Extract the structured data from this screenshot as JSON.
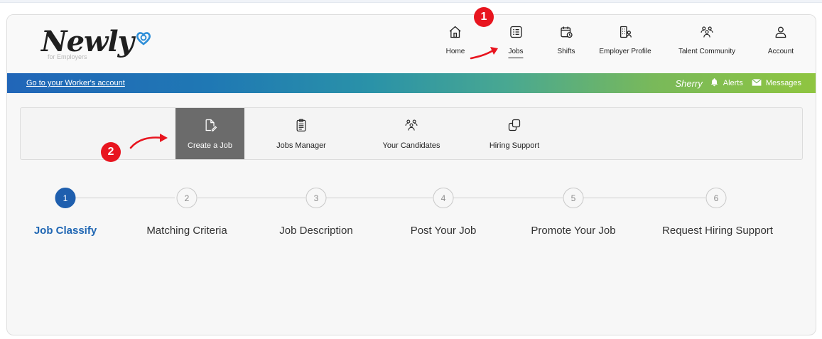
{
  "brand": {
    "name": "Newly",
    "tagline": "for Employers"
  },
  "topnav": {
    "items": [
      {
        "label": "Home",
        "icon": "home-icon"
      },
      {
        "label": "Jobs",
        "icon": "jobs-list-icon",
        "active": true
      },
      {
        "label": "Shifts",
        "icon": "calendar-icon"
      },
      {
        "label": "Employer Profile",
        "icon": "building-profile-icon"
      },
      {
        "label": "Talent Community",
        "icon": "group-icon"
      },
      {
        "label": "Account",
        "icon": "person-icon"
      }
    ]
  },
  "bar": {
    "worker_link": "Go to your Worker's account",
    "user_name": "Sherry",
    "alerts_label": "Alerts",
    "messages_label": "Messages"
  },
  "subnav": {
    "items": [
      {
        "label": "Create a Job",
        "icon": "document-edit-icon",
        "active": true
      },
      {
        "label": "Jobs Manager",
        "icon": "clipboard-icon"
      },
      {
        "label": "Your Candidates",
        "icon": "candidates-icon"
      },
      {
        "label": "Hiring Support",
        "icon": "copy-icon"
      }
    ]
  },
  "stepper": {
    "steps": [
      {
        "number": "1",
        "label": "Job Classify",
        "active": true
      },
      {
        "number": "2",
        "label": "Matching Criteria"
      },
      {
        "number": "3",
        "label": "Job Description"
      },
      {
        "number": "4",
        "label": "Post Your Job"
      },
      {
        "number": "5",
        "label": "Promote Your Job"
      },
      {
        "number": "6",
        "label": "Request Hiring Support"
      }
    ]
  },
  "annotations": {
    "marker_1": "1",
    "marker_2": "2",
    "color": "#e8151f"
  },
  "colors": {
    "primary_blue": "#1f5fae",
    "gradient_start": "#2166b8",
    "gradient_end": "#8fc540",
    "active_tab_bg": "#6b6b6b"
  }
}
